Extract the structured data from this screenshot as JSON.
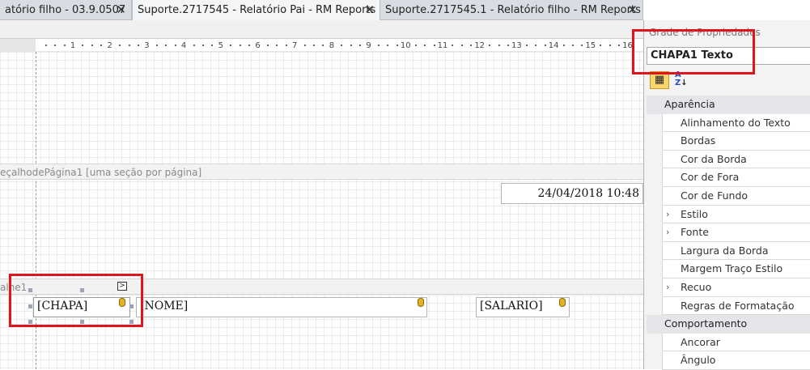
{
  "tabs": [
    {
      "label": "atório filho - 03.9.0507",
      "close": "✕",
      "active": false
    },
    {
      "label": "Suporte.2717545 - Relatório Pai - RM Reports",
      "close": "✕",
      "active": true
    },
    {
      "label": "Suporte.2717545.1 - Relatório filho - RM Reports",
      "close": "✕",
      "active": false
    }
  ],
  "ruler": {
    "ticks": [
      "1",
      "2",
      "3",
      "4",
      "5",
      "6",
      "7",
      "8",
      "9",
      "10",
      "11",
      "12",
      "13",
      "14",
      "15",
      "16"
    ]
  },
  "bands": {
    "page_header": "eçalhodePágina1 [uma seção por página]",
    "detail": "alhe1"
  },
  "fields": {
    "date": "24/04/2018 10:48",
    "chapa": "[CHAPA]",
    "nome": "[NOME]",
    "salario": "[SALARIO]",
    "smart_tag": ">"
  },
  "property_grid": {
    "title": "Grade de Propriedades",
    "selected_object": "CHAPA1  Texto",
    "toolbar": {
      "categorized_icon": "categorized-icon",
      "alphabetical_label": "A Z"
    },
    "rows": [
      {
        "type": "category",
        "label": "Aparência"
      },
      {
        "type": "prop",
        "label": "Alinhamento do Texto",
        "expandable": false
      },
      {
        "type": "prop",
        "label": "Bordas",
        "expandable": false
      },
      {
        "type": "prop",
        "label": "Cor da Borda",
        "expandable": false
      },
      {
        "type": "prop",
        "label": "Cor de Fora",
        "expandable": false
      },
      {
        "type": "prop",
        "label": "Cor de Fundo",
        "expandable": false
      },
      {
        "type": "prop",
        "label": "Estilo",
        "expandable": true
      },
      {
        "type": "prop",
        "label": "Fonte",
        "expandable": true
      },
      {
        "type": "prop",
        "label": "Largura da Borda",
        "expandable": false
      },
      {
        "type": "prop",
        "label": "Margem Traço Estilo",
        "expandable": false
      },
      {
        "type": "prop",
        "label": "Recuo",
        "expandable": true
      },
      {
        "type": "prop",
        "label": "Regras de Formatação",
        "expandable": false
      },
      {
        "type": "category",
        "label": "Comportamento"
      },
      {
        "type": "prop",
        "label": "Ancorar",
        "expandable": false
      },
      {
        "type": "prop",
        "label": "Ângulo",
        "expandable": false
      }
    ]
  },
  "colors": {
    "highlight": "#e0141b",
    "db_icon": "#e2b220"
  }
}
